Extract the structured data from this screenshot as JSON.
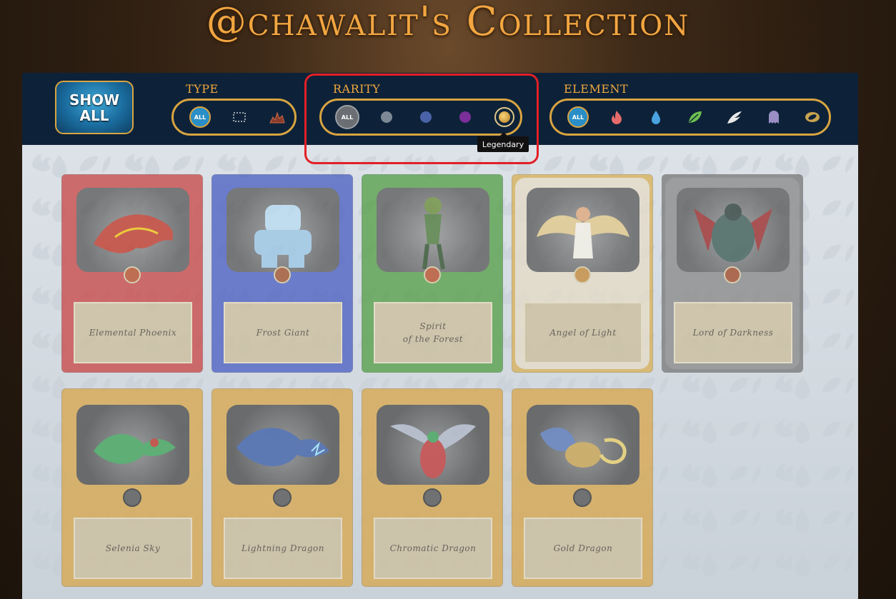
{
  "page": {
    "title": "@chawalit's Collection"
  },
  "filters": {
    "show_all_label": "SHOW ALL",
    "type": {
      "label": "TYPE",
      "options": [
        {
          "name": "all",
          "label": "ALL",
          "icon": "all-badge"
        },
        {
          "name": "summoner",
          "label": "",
          "icon": "summoner-frame-icon"
        },
        {
          "name": "monster",
          "label": "",
          "icon": "monster-burst-icon"
        }
      ]
    },
    "rarity": {
      "label": "RARITY",
      "options": [
        {
          "name": "all",
          "label": "ALL",
          "color": "#6b6f73"
        },
        {
          "name": "common",
          "label": "",
          "color": "#7c8994"
        },
        {
          "name": "rare",
          "label": "",
          "color": "#4a63a8"
        },
        {
          "name": "epic",
          "label": "",
          "color": "#7b2f9a"
        },
        {
          "name": "legendary",
          "label": "",
          "color": "#d9a03a"
        }
      ],
      "tooltip": "Legendary"
    },
    "element": {
      "label": "ELEMENT",
      "options": [
        {
          "name": "all",
          "label": "ALL",
          "icon": "all-badge"
        },
        {
          "name": "fire",
          "icon": "fire-icon",
          "color": "#e56b6b"
        },
        {
          "name": "water",
          "icon": "water-drop-icon",
          "color": "#4aa3e0"
        },
        {
          "name": "earth",
          "icon": "leaf-icon",
          "color": "#6dbf4f"
        },
        {
          "name": "life",
          "icon": "wing-icon",
          "color": "#e8e8e8"
        },
        {
          "name": "death",
          "icon": "ghost-icon",
          "color": "#9a8ec5"
        },
        {
          "name": "dragon",
          "icon": "dragon-egg-icon",
          "color": "#c9a450"
        }
      ]
    }
  },
  "cards": [
    {
      "name": "Elemental Phoenix",
      "frame_color": "#c94a4a",
      "orb_color": "#b8502a",
      "creature_color": "#c0392b"
    },
    {
      "name": "Frost Giant",
      "frame_color": "#4d61c3",
      "orb_color": "#a0522d",
      "creature_color": "#9cc7e6"
    },
    {
      "name": "Spirit\nof the Forest",
      "frame_color": "#57a04a",
      "orb_color": "#b8502a",
      "creature_color": "#4e7a3a"
    },
    {
      "name": "Angel of Light",
      "frame_color": "#d9b25a",
      "orb_color": "#c58a3a",
      "creature_color": "#e8d9b3"
    },
    {
      "name": "Lord of Darkness",
      "frame_color": "#7a7a7a",
      "orb_color": "#a24a2a",
      "creature_color": "#3d5c55"
    },
    {
      "name": "Selenia Sky",
      "frame_color": "#d8a84f",
      "orb_color": "#555555",
      "creature_color": "#3fa35a"
    },
    {
      "name": "Lightning Dragon",
      "frame_color": "#d8a84f",
      "orb_color": "#555555",
      "creature_color": "#3e5fa8"
    },
    {
      "name": "Chromatic Dragon",
      "frame_color": "#d8a84f",
      "orb_color": "#555555",
      "creature_color": "#c23b3b"
    },
    {
      "name": "Gold Dragon",
      "frame_color": "#d8a84f",
      "orb_color": "#555555",
      "creature_color": "#5a79b8"
    }
  ]
}
